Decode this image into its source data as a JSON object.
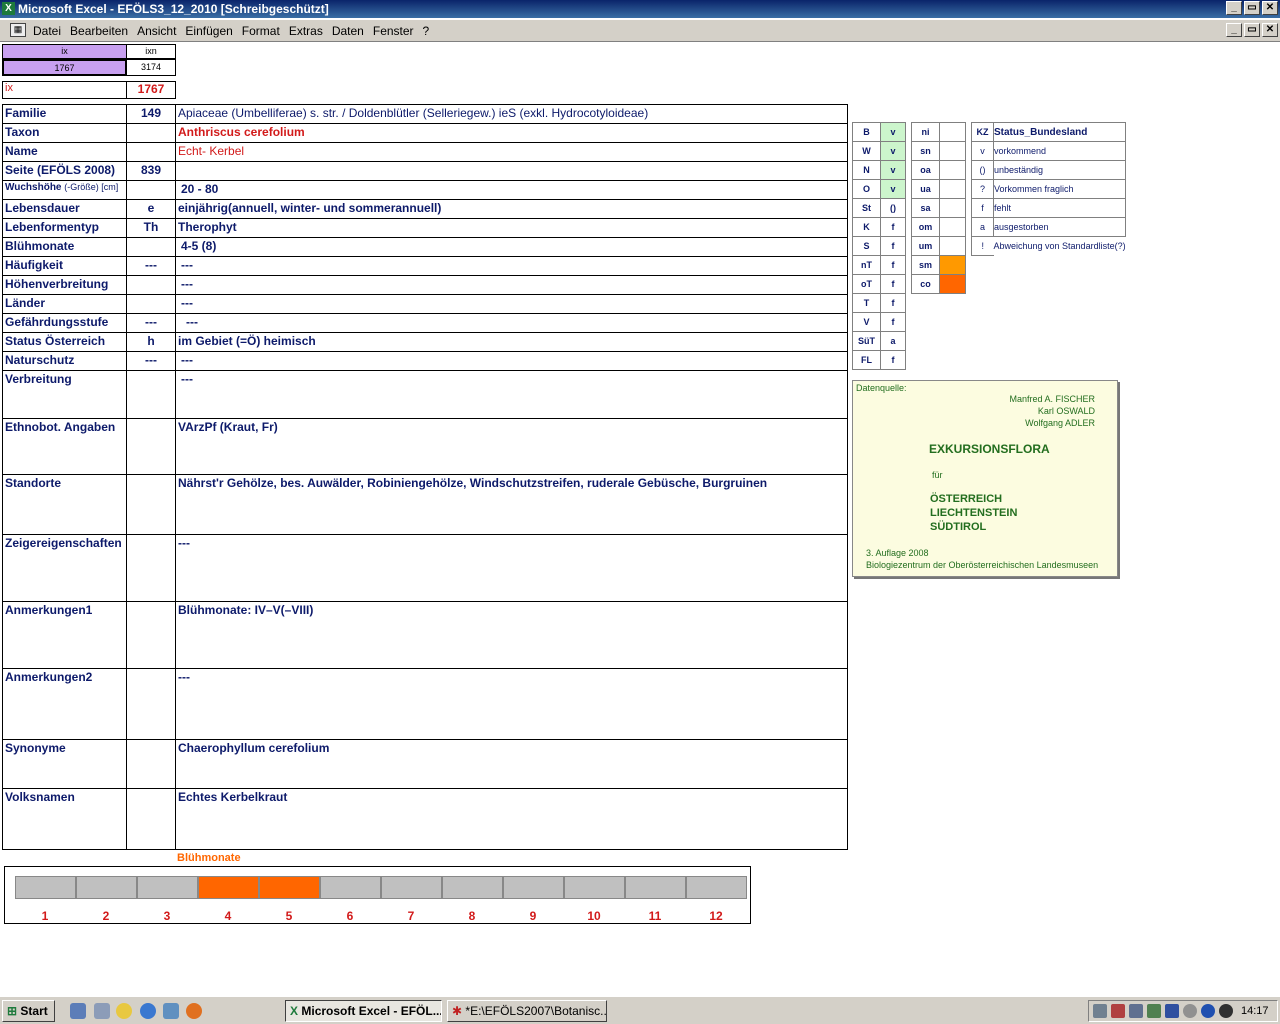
{
  "window": {
    "title": "Microsoft Excel - EFÖLS3_12_2010  [Schreibgeschützt]",
    "app_icon_glyph": "X",
    "controls": [
      "_",
      "▭",
      "✕"
    ]
  },
  "menu": {
    "items": [
      "Datei",
      "Bearbeiten",
      "Ansicht",
      "Einfügen",
      "Format",
      "Extras",
      "Daten",
      "Fenster",
      "?"
    ]
  },
  "index_box": {
    "h1": "ix",
    "h2": "ixn",
    "v1": "1767",
    "v2": "3174",
    "ix_label": "ix",
    "ix_value": "1767"
  },
  "rows": [
    {
      "label": "Familie",
      "code": "149",
      "value": "Apiaceae (Umbelliferae) s. str.  /  Doldenblütler (Selleriegew.) ieS (exkl. Hydrocotyloideae)"
    },
    {
      "label": "Taxon",
      "code": "",
      "value": "Anthriscus cerefolium"
    },
    {
      "label": "Name",
      "code": "",
      "value": "Echt- Kerbel"
    },
    {
      "label": "Seite (EFÖLS 2008)",
      "code": "839",
      "value": ""
    },
    {
      "label": "Wuchshöhe",
      "label_suffix": "(-Größe) [cm]",
      "code": "",
      "value": "20 - 80"
    },
    {
      "label": "Lebensdauer",
      "code": "e",
      "value": "einjährig(annuell, winter- und sommerannuell)"
    },
    {
      "label": "Lebenformentyp",
      "code": "Th",
      "value": "Therophyt"
    },
    {
      "label": "Blühmonate",
      "code": "",
      "value": "4-5 (8)"
    },
    {
      "label": "Häufigkeit",
      "code": "---",
      "value": "---"
    },
    {
      "label": "Höhenverbreitung",
      "code": "",
      "value": "---"
    },
    {
      "label": "Länder",
      "code": "",
      "value": "---"
    },
    {
      "label": "Gefährdungsstufe",
      "code": "---",
      "value": "---"
    },
    {
      "label": "Status Österreich",
      "code": "h",
      "value": "im Gebiet (=Ö) heimisch"
    },
    {
      "label": "Naturschutz",
      "code": "---",
      "value": "---"
    },
    {
      "label": "Verbreitung",
      "code": "",
      "value": "---"
    },
    {
      "label": "Ethnobot. Angaben",
      "code": "",
      "value": "VArzPf (Kraut, Fr)"
    },
    {
      "label": "Standorte",
      "code": "",
      "value": "Nährst'r Gehölze, bes. Auwälder, Robiniengehölze, Windschutzstreifen, ruderale Gebüsche, Burgruinen"
    },
    {
      "label": "Zeigereigenschaften",
      "code": "",
      "value": "---"
    },
    {
      "label": "Anmerkungen1",
      "code": "",
      "value": "Blühmonate:  IV–V(–VIII)"
    },
    {
      "label": "Anmerkungen2",
      "code": "",
      "value": "---"
    },
    {
      "label": "Synonyme",
      "code": "",
      "value": "Chaerophyllum cerefolium"
    },
    {
      "label": "Volksnamen",
      "code": "",
      "value": "Echtes Kerbelkraut"
    }
  ],
  "states": [
    {
      "code": "B",
      "val": "v"
    },
    {
      "code": "W",
      "val": "v"
    },
    {
      "code": "N",
      "val": "v"
    },
    {
      "code": "O",
      "val": "v"
    },
    {
      "code": "St",
      "val": "()"
    },
    {
      "code": "K",
      "val": "f"
    },
    {
      "code": "S",
      "val": "f"
    },
    {
      "code": "nT",
      "val": "f"
    },
    {
      "code": "oT",
      "val": "f"
    },
    {
      "code": "T",
      "val": "f"
    },
    {
      "code": "V",
      "val": "f"
    },
    {
      "code": "SüT",
      "val": "a"
    },
    {
      "code": "FL",
      "val": "f"
    }
  ],
  "altitudes": [
    {
      "code": "ni",
      "val": ""
    },
    {
      "code": "sn",
      "val": ""
    },
    {
      "code": "oa",
      "val": ""
    },
    {
      "code": "ua",
      "val": ""
    },
    {
      "code": "sa",
      "val": ""
    },
    {
      "code": "om",
      "val": ""
    },
    {
      "code": "um",
      "val": ""
    },
    {
      "code": "sm",
      "val": ""
    },
    {
      "code": "co",
      "val": ""
    }
  ],
  "altitude_colors": {
    "sm": "#ff9900",
    "co": "#ff6600"
  },
  "legend": {
    "header_code": "KZ",
    "header_label": "Status_Bundesland",
    "items": [
      {
        "code": "v",
        "label": "vorkommend"
      },
      {
        "code": "()",
        "label": "unbeständig"
      },
      {
        "code": "?",
        "label": "Vorkommen fraglich"
      },
      {
        "code": "f",
        "label": "fehlt"
      },
      {
        "code": "a",
        "label": "ausgestorben"
      },
      {
        "code": "!",
        "label": "Abweichung von Standardliste(?)"
      }
    ]
  },
  "source": {
    "label": "Datenquelle:",
    "authors": [
      "Manfred A. FISCHER",
      "Karl OSWALD",
      "Wolfgang ADLER"
    ],
    "title": "EXKURSIONSFLORA",
    "fuer": "für",
    "regions": [
      "ÖSTERREICH",
      "LIECHTENSTEIN",
      "SÜDTIROL"
    ],
    "edition": "3. Auflage 2008",
    "publisher": "Biologiezentrum der Oberösterreichischen Landesmuseen"
  },
  "bloom": {
    "title": "Blühmonate",
    "months": [
      "1",
      "2",
      "3",
      "4",
      "5",
      "6",
      "7",
      "8",
      "9",
      "10",
      "11",
      "12"
    ],
    "active": [
      false,
      false,
      false,
      true,
      true,
      false,
      false,
      false,
      false,
      false,
      false,
      false
    ],
    "active_color": "#ff6600",
    "inactive_color": "#c0c0c0"
  },
  "taskbar": {
    "start": "Start",
    "tasks": [
      "Microsoft Excel - EFÖL...",
      "*E:\\EFÖLS2007\\Botanisc..."
    ],
    "clock": "14:17"
  }
}
